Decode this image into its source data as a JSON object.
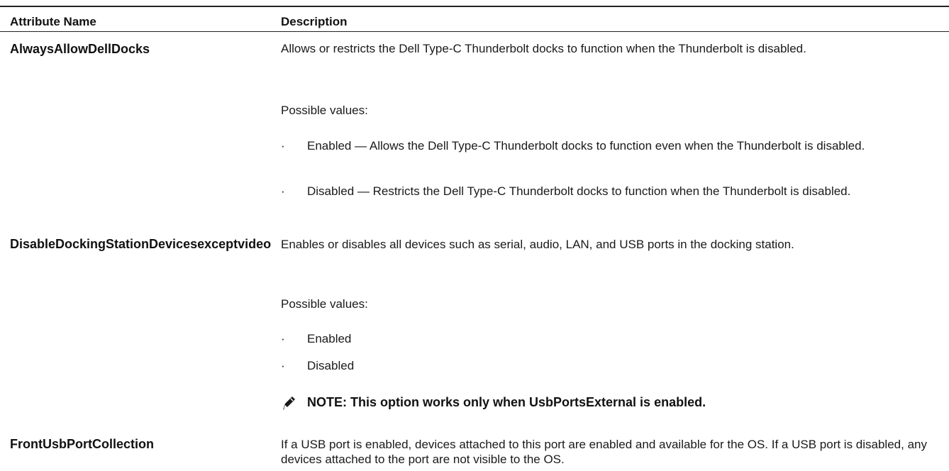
{
  "table": {
    "headers": {
      "attribute_name": "Attribute Name",
      "description": "Description"
    },
    "rows": [
      {
        "name": "AlwaysAllowDellDocks",
        "description": "Allows or restricts the Dell Type-C Thunderbolt docks to function when the Thunderbolt is disabled.",
        "possible_values_label": "Possible values:",
        "values": [
          "Enabled — Allows the Dell Type-C Thunderbolt docks to function even when the Thunderbolt is disabled.",
          "Disabled — Restricts the Dell Type-C Thunderbolt docks to function when the Thunderbolt is disabled."
        ]
      },
      {
        "name": "DisableDockingStationDevicesexceptvideo",
        "description": "Enables or disables all devices such as serial, audio, LAN, and USB ports in the docking station.",
        "possible_values_label": "Possible values:",
        "values": [
          "Enabled",
          "Disabled"
        ],
        "note": "NOTE: This option works only when UsbPortsExternal is enabled.",
        "note_icon": "pencil-note-icon"
      },
      {
        "name": "FrontUsbPortCollection",
        "description": "If a USB port is enabled, devices attached to this port are enabled and available for the OS. If a USB port is disabled, any devices attached to the port are not visible to the OS."
      }
    ]
  },
  "bullet_glyph": "·",
  "colors": {
    "text": "#111111",
    "rule": "#222222"
  }
}
